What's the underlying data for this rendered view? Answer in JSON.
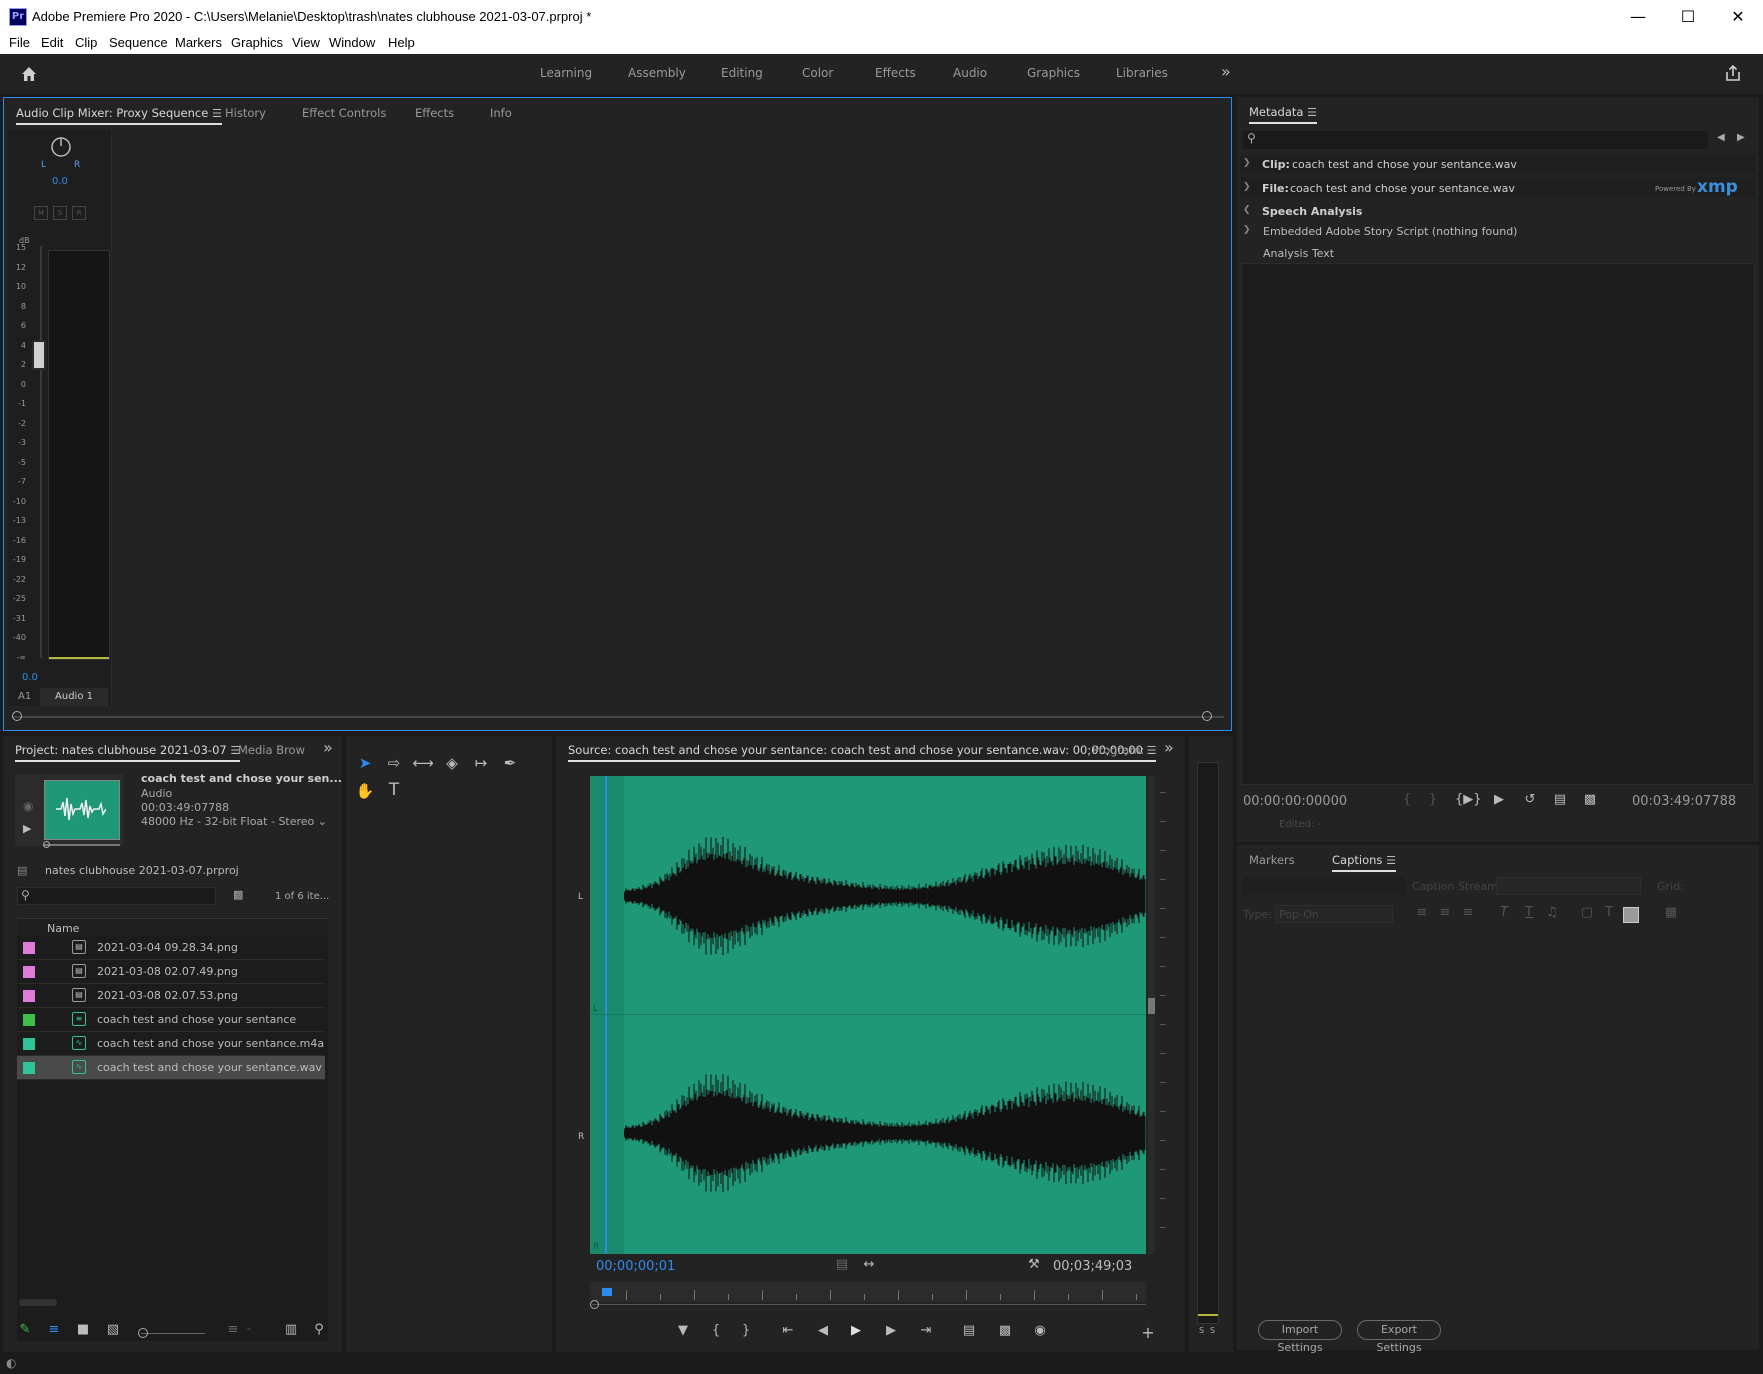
{
  "window": {
    "title": "Adobe Premiere Pro 2020 - C:\\Users\\Melanie\\Desktop\\trash\\nates clubhouse 2021-03-07.prproj *",
    "app_icon": "Pr"
  },
  "menu": [
    "File",
    "Edit",
    "Clip",
    "Sequence",
    "Markers",
    "Graphics",
    "View",
    "Window",
    "Help"
  ],
  "workspaces": [
    "Learning",
    "Assembly",
    "Editing",
    "Color",
    "Effects",
    "Audio",
    "Graphics",
    "Libraries"
  ],
  "top_panel": {
    "tabs": [
      "Audio Clip Mixer: Proxy Sequence",
      "History",
      "Effect Controls",
      "Effects",
      "Info"
    ],
    "mixer": {
      "pan_l": "L",
      "pan_r": "R",
      "pan_value": "0.0",
      "db_label": "dB",
      "scale": [
        "15",
        "12",
        "10",
        "8",
        "6",
        "4",
        "2",
        "0",
        "-1",
        "-2",
        "-3",
        "-5",
        "-7",
        "-10",
        "-13",
        "-16",
        "-19",
        "-22",
        "-25",
        "-31",
        "-40",
        "-∞"
      ],
      "level": "0.0",
      "track_id": "A1",
      "track_name": "Audio 1",
      "msr": [
        "M",
        "S",
        "R"
      ]
    }
  },
  "metadata": {
    "tab": "Metadata",
    "clip_label": "Clip:",
    "clip_value": "coach test and chose your sentance.wav",
    "file_label": "File:",
    "file_value": "coach test and chose your sentance.wav",
    "powered_by": "Powered By",
    "xmp": "xmp",
    "speech_analysis": "Speech Analysis",
    "embedded": "Embedded Adobe Story Script (nothing found)",
    "analysis_text": "Analysis Text",
    "tc_start": "00:00:00:00000",
    "tc_end": "00:03:49:07788",
    "edited": "Edited: -"
  },
  "captions": {
    "tabs": [
      "Markers",
      "Captions"
    ],
    "caption_stream": "Caption Stream:",
    "grid": "Grid:",
    "type": "Type:",
    "type_value": "Pop-On",
    "import": "Import Settings",
    "export": "Export Settings"
  },
  "project": {
    "tabs": [
      "Project: nates clubhouse 2021-03-07",
      "Media Brow"
    ],
    "preview": {
      "name": "coach test and chose your sen...",
      "kind": "Audio",
      "duration": "00:03:49:07788",
      "format": "48000 Hz - 32-bit Float - Stereo"
    },
    "project_file": "nates clubhouse 2021-03-07.prproj",
    "count": "1 of 6 ite...",
    "column_name": "Name",
    "items": [
      {
        "name": "2021-03-04 09.28.34.png",
        "color": "#e07ad8",
        "icon": "image"
      },
      {
        "name": "2021-03-08 02.07.49.png",
        "color": "#e07ad8",
        "icon": "image"
      },
      {
        "name": "2021-03-08 02.07.53.png",
        "color": "#e07ad8",
        "icon": "image"
      },
      {
        "name": "coach test and chose your sentance",
        "color": "#3fbf4a",
        "icon": "sequence"
      },
      {
        "name": "coach test and chose your sentance.m4a",
        "color": "#2fc39a",
        "icon": "audio"
      },
      {
        "name": "coach test and chose your sentance.wav",
        "color": "#2fc39a",
        "icon": "audio"
      }
    ]
  },
  "source": {
    "tab": "Source: coach test and chose your sentance: coach test and chose your sentance.wav: 00;00;00;00",
    "program_tab": "Program:",
    "channel_l": "L",
    "channel_r": "R",
    "tc_current": "00;00;00;01",
    "tc_duration": "00;03;49;03"
  },
  "meter_labels": [
    "S",
    "S"
  ],
  "colors": {
    "accent_blue": "#2d8ceb",
    "waveform_bg": "#1f9877",
    "panel_bg": "#232323"
  }
}
